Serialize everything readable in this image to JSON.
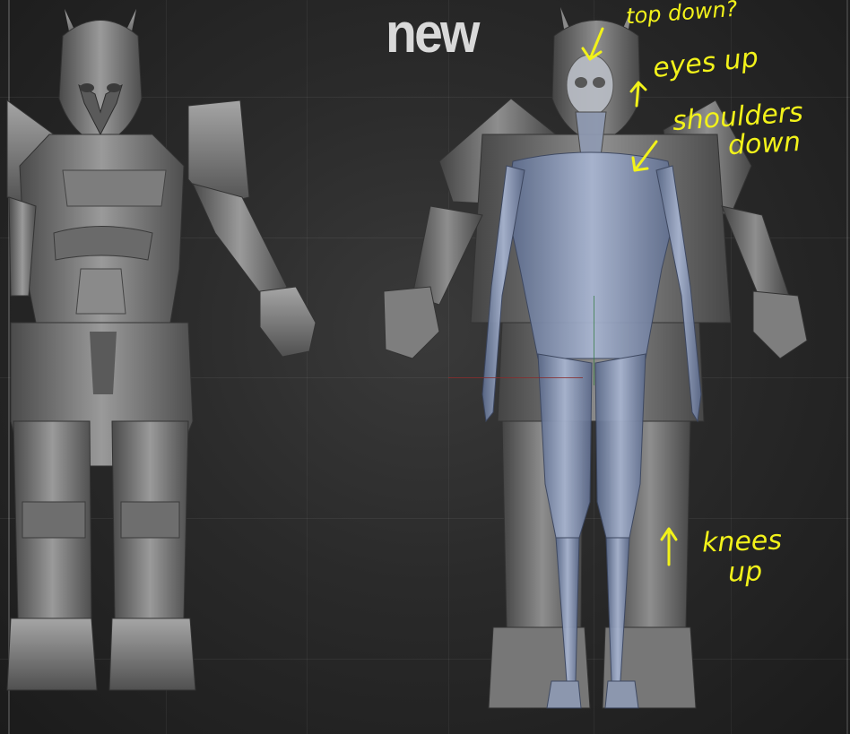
{
  "canvas": {
    "label": "new"
  },
  "annotations": {
    "note1": "top down?",
    "note2": "eyes up",
    "note3": "shoulders",
    "note4": "down",
    "note5": "knees",
    "note6": "up"
  },
  "colors": {
    "background": "#2a2a2a",
    "annotation": "#f2f21a",
    "armor": "#8a8a8a",
    "anatomy_overlay": "#8fa4c8"
  },
  "icons": {
    "arrow": "arrow-annotation-icon"
  }
}
